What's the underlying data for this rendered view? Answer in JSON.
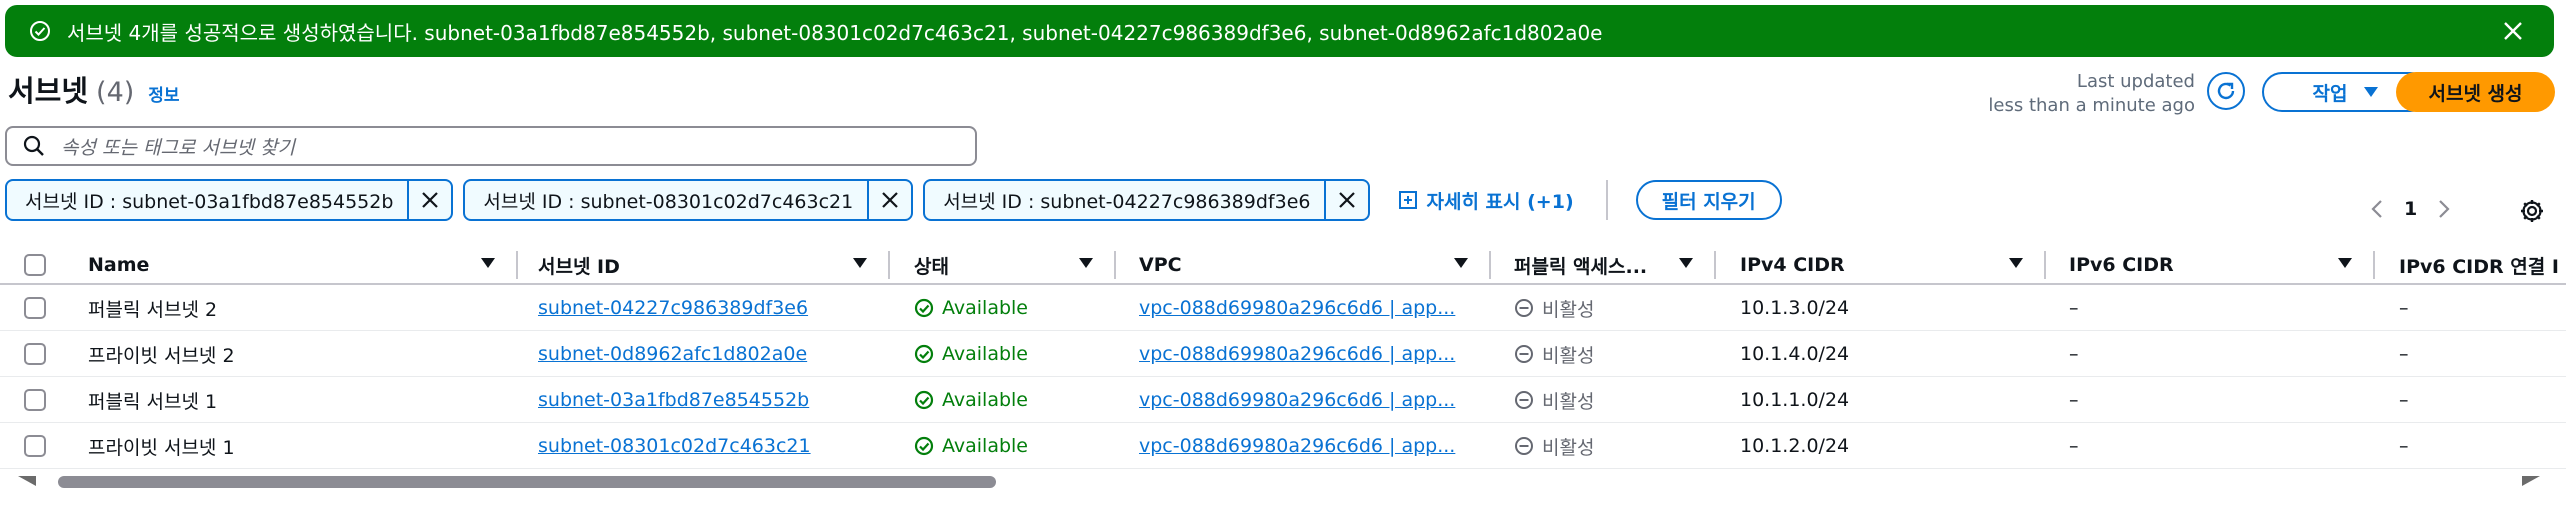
{
  "flash": {
    "message": "서브넷 4개를 성공적으로 생성하였습니다. subnet-03a1fbd87e854552b, subnet-08301c02d7c463c21, subnet-04227c986389df3e6, subnet-0d8962afc1d802a0e",
    "color": "#037f0c"
  },
  "header": {
    "title": "서브넷",
    "count": "(4)",
    "info_link": "정보",
    "last_updated_line1": "Last updated",
    "last_updated_line2": "less than a minute ago",
    "actions_label": "작업",
    "create_label": "서브넷 생성"
  },
  "search": {
    "placeholder": "속성 또는 태그로 서브넷 찾기"
  },
  "filters": {
    "tokens": [
      "서브넷 ID : subnet-03a1fbd87e854552b",
      "서브넷 ID : subnet-08301c02d7c463c21",
      "서브넷 ID : subnet-04227c986389df3e6"
    ],
    "show_more": "자세히 표시 (+1)",
    "clear": "필터 지우기"
  },
  "pagination": {
    "page": "1"
  },
  "table": {
    "columns": [
      "Name",
      "서브넷 ID",
      "상태",
      "VPC",
      "퍼블릭 액세스...",
      "IPv4 CIDR",
      "IPv6 CIDR",
      "IPv6 CIDR 연결 I"
    ],
    "rows": [
      {
        "name": "퍼블릭 서브넷 2",
        "subnet_id": "subnet-04227c986389df3e6",
        "state": "Available",
        "vpc": "vpc-088d69980a296c6d6 | app...",
        "public_access": "비활성",
        "ipv4": "10.1.3.0/24",
        "ipv6": "–",
        "ipv6_assoc": "–"
      },
      {
        "name": "프라이빗 서브넷 2",
        "subnet_id": "subnet-0d8962afc1d802a0e",
        "state": "Available",
        "vpc": "vpc-088d69980a296c6d6 | app...",
        "public_access": "비활성",
        "ipv4": "10.1.4.0/24",
        "ipv6": "–",
        "ipv6_assoc": "–"
      },
      {
        "name": "퍼블릭 서브넷 1",
        "subnet_id": "subnet-03a1fbd87e854552b",
        "state": "Available",
        "vpc": "vpc-088d69980a296c6d6 | app...",
        "public_access": "비활성",
        "ipv4": "10.1.1.0/24",
        "ipv6": "–",
        "ipv6_assoc": "–"
      },
      {
        "name": "프라이빗 서브넷 1",
        "subnet_id": "subnet-08301c02d7c463c21",
        "state": "Available",
        "vpc": "vpc-088d69980a296c6d6 | app...",
        "public_access": "비활성",
        "ipv4": "10.1.2.0/24",
        "ipv6": "–",
        "ipv6_assoc": "–"
      }
    ]
  },
  "colors": {
    "accent": "#0972d3",
    "primary_button": "#ff9900",
    "success": "#037f0c"
  }
}
